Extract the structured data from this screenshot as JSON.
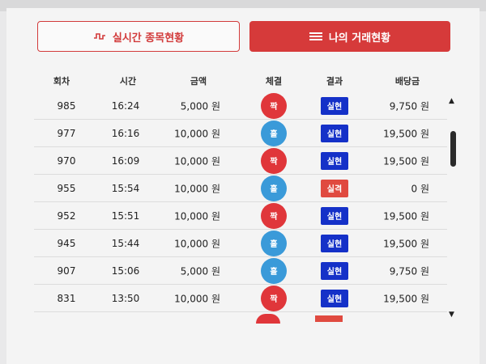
{
  "tabs": {
    "live_label": "실시간 종목현황",
    "mine_label": "나의 거래현황"
  },
  "columns": [
    "회차",
    "시간",
    "금액",
    "체결",
    "결과",
    "배당금"
  ],
  "rows": [
    {
      "round": "985",
      "time": "16:24",
      "amount": "5,000 원",
      "pick": "짝",
      "pick_color": "red",
      "result": "실현",
      "result_type": "win",
      "payout": "9,750 원"
    },
    {
      "round": "977",
      "time": "16:16",
      "amount": "10,000 원",
      "pick": "홀",
      "pick_color": "blue",
      "result": "실현",
      "result_type": "win",
      "payout": "19,500 원"
    },
    {
      "round": "970",
      "time": "16:09",
      "amount": "10,000 원",
      "pick": "짝",
      "pick_color": "red",
      "result": "실현",
      "result_type": "win",
      "payout": "19,500 원"
    },
    {
      "round": "955",
      "time": "15:54",
      "amount": "10,000 원",
      "pick": "홀",
      "pick_color": "blue",
      "result": "실격",
      "result_type": "lose",
      "payout": "0 원"
    },
    {
      "round": "952",
      "time": "15:51",
      "amount": "10,000 원",
      "pick": "짝",
      "pick_color": "red",
      "result": "실현",
      "result_type": "win",
      "payout": "19,500 원"
    },
    {
      "round": "945",
      "time": "15:44",
      "amount": "10,000 원",
      "pick": "홀",
      "pick_color": "blue",
      "result": "실현",
      "result_type": "win",
      "payout": "19,500 원"
    },
    {
      "round": "907",
      "time": "15:06",
      "amount": "5,000 원",
      "pick": "홀",
      "pick_color": "blue",
      "result": "실현",
      "result_type": "win",
      "payout": "9,750 원"
    },
    {
      "round": "831",
      "time": "13:50",
      "amount": "10,000 원",
      "pick": "짝",
      "pick_color": "red",
      "result": "실현",
      "result_type": "win",
      "payout": "19,500 원"
    }
  ],
  "colors": {
    "accent": "#d63a3a",
    "odd": "#3a9ad9",
    "even": "#e0363a",
    "win": "#1531c8",
    "lose": "#e04a40"
  },
  "icons": {
    "live_tab": "pulse-wave-icon",
    "mine_tab": "list-lines-icon",
    "scroll_up": "triangle-up-icon",
    "scroll_down": "triangle-down-icon"
  }
}
